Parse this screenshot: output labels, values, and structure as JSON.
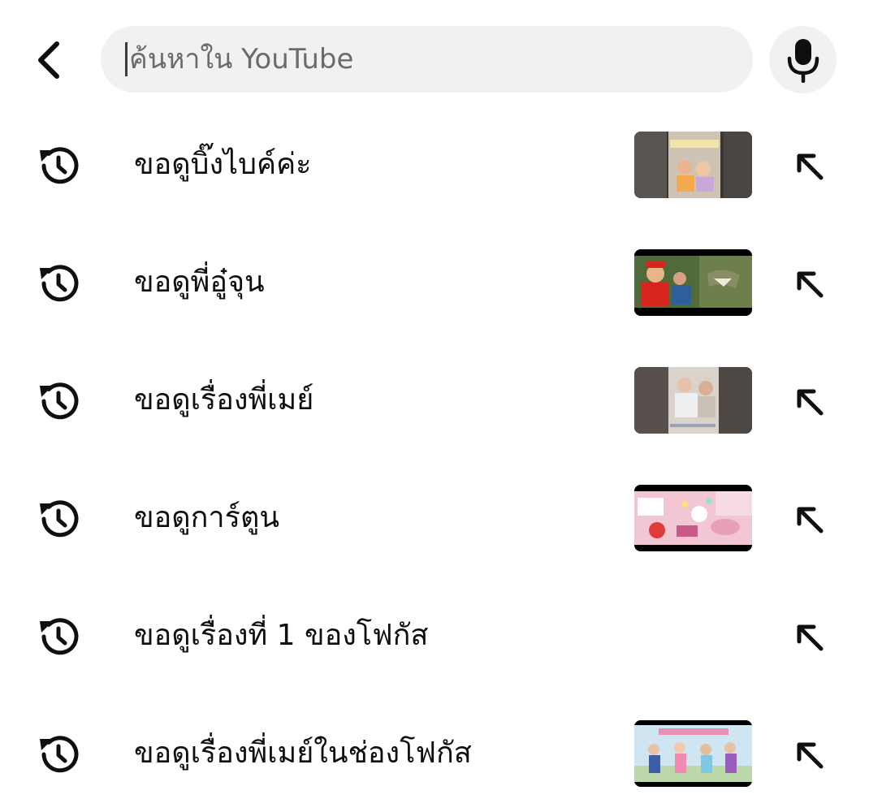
{
  "search": {
    "placeholder": "ค้นหาใน YouTube",
    "value": ""
  },
  "icons": {
    "back": "chevron-left-icon",
    "mic": "microphone-icon",
    "history": "history-clock-icon",
    "fill": "arrow-up-left-icon"
  },
  "suggestions": [
    {
      "label": "ขอดูบิ๊งไบค์ค่ะ",
      "has_thumbnail": true
    },
    {
      "label": "ขอดูพี่อู๋จุน",
      "has_thumbnail": true
    },
    {
      "label": "ขอดูเรื่องพี่เมย์",
      "has_thumbnail": true
    },
    {
      "label": "ขอดูการ์ตูน",
      "has_thumbnail": true
    },
    {
      "label": "ขอดูเรื่องที่ 1 ของโฟกัส",
      "has_thumbnail": false
    },
    {
      "label": "ขอดูเรื่องพี่เมย์ในช่องโฟกัส",
      "has_thumbnail": true
    }
  ],
  "colors": {
    "text": "#0f0f0f",
    "search_bg": "#f1f1f1",
    "placeholder": "#6b6b6b"
  }
}
